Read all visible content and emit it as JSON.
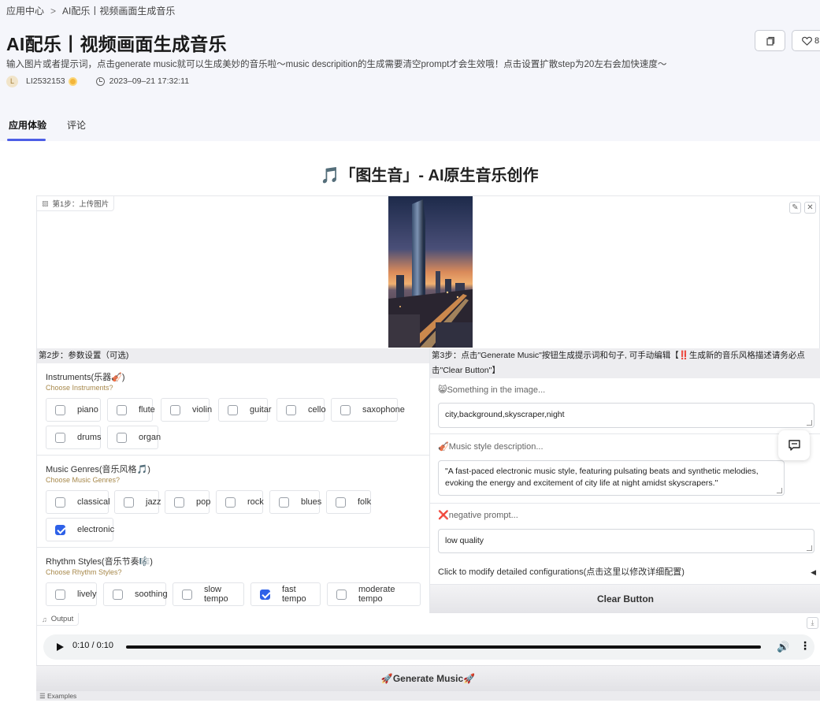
{
  "breadcrumb": {
    "root": "应用中心",
    "sep": ">",
    "current": "AI配乐丨视频画面生成音乐"
  },
  "header": {
    "title": "AI配乐丨视频画面生成音乐",
    "description": "输入图片或者提示词，点击generate music就可以生成美妙的音乐啦～music descripition的生成需要清空prompt才会生效哦！点击设置扩散step为20左右会加快速度～",
    "author": "LI2532153",
    "avatar_letter": "L",
    "datetime": "2023–09–21 17:32:11",
    "like_count": "8"
  },
  "tabs": [
    {
      "label": "应用体验"
    },
    {
      "label": "评论"
    }
  ],
  "app": {
    "heading": "🎵「图生音」- AI原生音乐创作",
    "step1_label": "第1步：上传图片",
    "step2_header": "第2步：参数设置（可选)",
    "step3_header": "第3步：点击\"Generate Music\"按钮生成提示词和句子, 可手动编辑【‼️生成新的音乐风格描述请务必点击\"Clear Button\"】",
    "instruments": {
      "title": "Instruments(乐器🎻)",
      "info": "Choose Instruments?",
      "options": [
        {
          "label": "piano",
          "checked": false
        },
        {
          "label": "flute",
          "checked": false
        },
        {
          "label": "violin",
          "checked": false
        },
        {
          "label": "guitar",
          "checked": false
        },
        {
          "label": "cello",
          "checked": false
        },
        {
          "label": "saxophone",
          "checked": false
        },
        {
          "label": "drums",
          "checked": false
        },
        {
          "label": "organ",
          "checked": false
        }
      ]
    },
    "genres": {
      "title": "Music Genres(音乐风格🎵)",
      "info": "Choose Music Genres?",
      "options": [
        {
          "label": "classical",
          "checked": false
        },
        {
          "label": "jazz",
          "checked": false
        },
        {
          "label": "pop",
          "checked": false
        },
        {
          "label": "rock",
          "checked": false
        },
        {
          "label": "blues",
          "checked": false
        },
        {
          "label": "folk",
          "checked": false
        },
        {
          "label": "electronic",
          "checked": true
        }
      ]
    },
    "rhythms": {
      "title": "Rhythm Styles(音乐节奏🎼)",
      "info": "Choose Rhythm Styles?",
      "options": [
        {
          "label": "lively",
          "checked": false
        },
        {
          "label": "soothing",
          "checked": false
        },
        {
          "label": "slow tempo",
          "checked": false
        },
        {
          "label": "fast tempo",
          "checked": true
        },
        {
          "label": "moderate tempo",
          "checked": false
        }
      ]
    },
    "image_field": {
      "label": "😸Something in the image...",
      "value": "city,background,skyscraper,night"
    },
    "style_field": {
      "label": "🎻Music style description...",
      "value": "\"A fast-paced electronic music style, featuring pulsating beats and synthetic melodies, evoking the energy and excitement of city life at night amidst skyscrapers.\""
    },
    "negative_field": {
      "label": "❌negative prompt...",
      "value": "low quality"
    },
    "accordion_label": "Click to modify detailed configurations(点击这里以修改详细配置)",
    "clear_button": "Clear Button",
    "output_label": "Output",
    "audio_time": "0:10 / 0:10",
    "audio_progress": 1.0,
    "generate_button": "🚀Generate Music🚀",
    "examples_label": "Examples"
  }
}
